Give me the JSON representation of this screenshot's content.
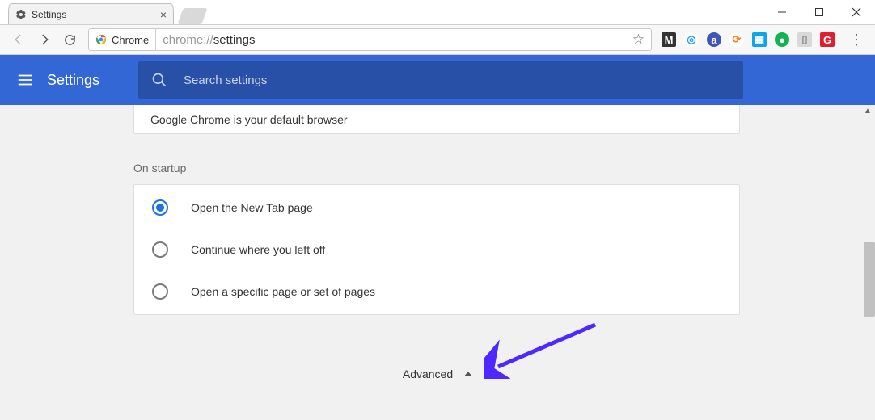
{
  "window": {
    "tab_title": "Settings"
  },
  "omnibox": {
    "secure_label": "Chrome",
    "url_prefix": "chrome://",
    "url_path": "settings"
  },
  "header": {
    "title": "Settings",
    "search_placeholder": "Search settings"
  },
  "default_browser_text": "Google Chrome is your default browser",
  "section_label": "On startup",
  "startup_options": [
    "Open the New Tab page",
    "Continue where you left off",
    "Open a specific page or set of pages"
  ],
  "advanced_label": "Advanced",
  "extension_icons": [
    {
      "bg": "#333",
      "fg": "#fff",
      "ch": "M"
    },
    {
      "bg": "#fff",
      "fg": "#1a9cff",
      "ch": "◎",
      "round": true
    },
    {
      "bg": "#4056b5",
      "fg": "#fff",
      "ch": "a",
      "round": true
    },
    {
      "bg": "#fff",
      "fg": "#ff7a18",
      "ch": "⟳",
      "round": true
    },
    {
      "bg": "#0ea5e9",
      "fg": "#fff",
      "ch": "▦"
    },
    {
      "bg": "#10b552",
      "fg": "#fff",
      "ch": "●",
      "round": true
    },
    {
      "bg": "#d9d9d9",
      "fg": "#888",
      "ch": "▯"
    },
    {
      "bg": "#e11d2e",
      "fg": "#fff",
      "ch": "G"
    }
  ]
}
